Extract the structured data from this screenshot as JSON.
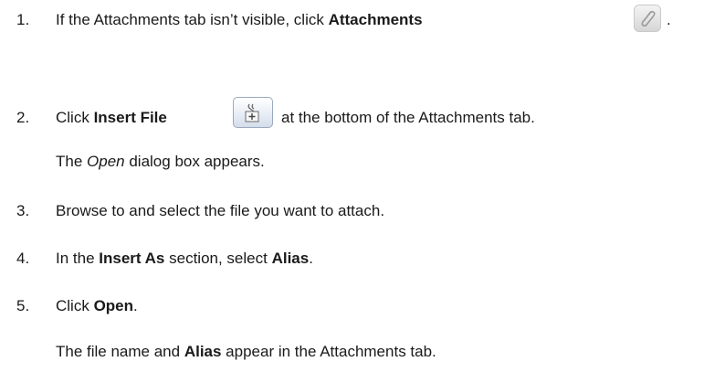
{
  "steps": [
    {
      "number": "1.",
      "before": "If the Attachments tab isn’t visible, click ",
      "bold": "Attachments",
      "after": ".",
      "icon": "paperclip-icon"
    },
    {
      "number": "2.",
      "before": "Click ",
      "bold": "Insert File",
      "after": "at the bottom of the Attachments tab.",
      "icon": "insert-file-icon",
      "result_italic": "Open",
      "result_rest": " dialog box appears.",
      "result_prefix": "The "
    },
    {
      "number": "3.",
      "text": "Browse to and select the file you want to attach."
    },
    {
      "number": "4.",
      "before": "In the ",
      "bold": "Insert As",
      "middle": " section, select ",
      "bold2": "Alias",
      "after": "."
    },
    {
      "number": "5.",
      "before": "Click ",
      "bold": "Open",
      "after": ".",
      "result_prefix": "The file name and ",
      "result_bold": "Alias",
      "result_rest": " appear in the Attachments tab."
    }
  ]
}
